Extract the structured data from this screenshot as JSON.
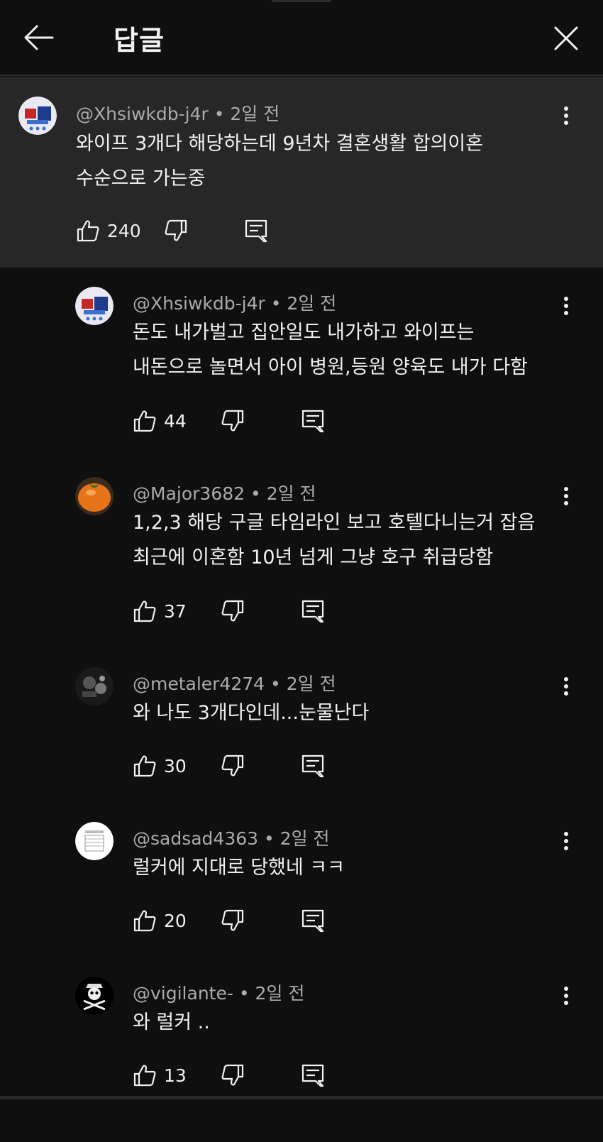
{
  "header": {
    "title": "답글"
  },
  "main_comment": {
    "author": "@Xhsiwkdb-j4r",
    "time": "2일 전",
    "lines": [
      "와이프 3개다 해당하는데 9년차 결혼생활 합의이혼",
      "수순으로 가는중"
    ],
    "likes": "240"
  },
  "replies": [
    {
      "author": "@Xhsiwkdb-j4r",
      "time": "2일 전",
      "lines": [
        "돈도 내가벌고 집안일도 내가하고 와이프는",
        "내돈으로 놀면서 아이 병원,등원 양육도 내가 다함"
      ],
      "likes": "44"
    },
    {
      "author": "@Major3682",
      "time": "2일 전",
      "lines": [
        "1,2,3 해당 구글 타임라인 보고 호텔다니는거 잡음",
        "최근에 이혼함 10년 넘게 그냥 호구 취급당함"
      ],
      "likes": "37"
    },
    {
      "author": "@metaler4274",
      "time": "2일 전",
      "lines": [
        "와 나도 3개다인데...눈물난다"
      ],
      "likes": "30"
    },
    {
      "author": "@sadsad4363",
      "time": "2일 전",
      "lines": [
        "럴커에 지대로 당했네 ㅋㅋ"
      ],
      "likes": "20"
    },
    {
      "author": "@vigilante-",
      "time": "2일 전",
      "lines": [
        "와 럴커 .."
      ],
      "likes": "13"
    }
  ],
  "meta_separator": " • ",
  "colors": {
    "background": "#0f0f0f",
    "highlight": "#272727",
    "text": "#f1f1f1",
    "meta": "#aaaaaa"
  }
}
